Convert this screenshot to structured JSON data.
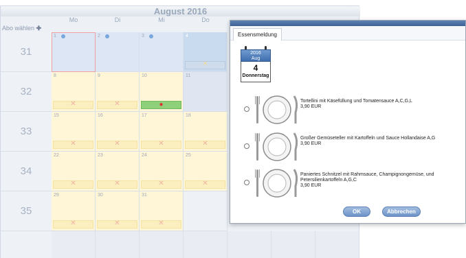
{
  "calendar": {
    "title": "August 2016",
    "days": [
      "Mo",
      "Di",
      "Mi",
      "Do"
    ],
    "abo_label": "Abo wählen",
    "abo_arrow": "✚",
    "weeks": [
      "31",
      "32",
      "33",
      "34",
      "35"
    ],
    "dates": {
      "w31": [
        "1",
        "2",
        "3",
        "4"
      ],
      "w32": [
        "8",
        "9",
        "10",
        "11"
      ],
      "w33": [
        "15",
        "16",
        "17",
        "18"
      ],
      "w34": [
        "22",
        "23",
        "24",
        "25"
      ],
      "w35": [
        "29",
        "30",
        "31"
      ]
    }
  },
  "dialog": {
    "tab": "Essensmeldung",
    "date": {
      "year": "2016",
      "month": "Aug",
      "day": "4",
      "weekday": "Donnerstag"
    },
    "options": [
      {
        "meal": "Tortellini mit Käsefüllung und Tomatensauce A,C,G,L",
        "price": "3,90 EUR"
      },
      {
        "meal": "Großer Gemüseteller mit Kartoffeln und Sauce Hollandaise A,G",
        "price": "3,90 EUR"
      },
      {
        "meal": "Paniertes Schnitzel mit Rahmsauce, Champignongemüse, und Petersilienkartoffeln A,G,C",
        "price": "3,90 EUR"
      }
    ],
    "ok_label": "OK",
    "cancel_label": "Abbrechen"
  }
}
